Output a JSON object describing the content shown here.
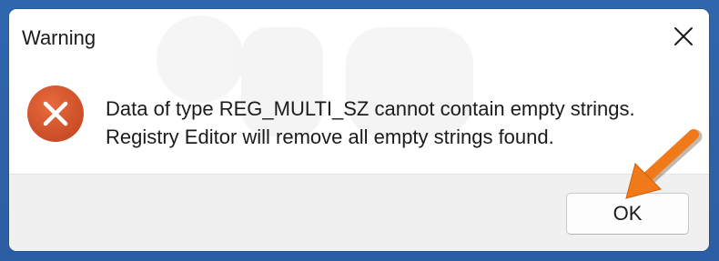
{
  "dialog": {
    "title": "Warning",
    "message_lines": [
      "Data of type REG_MULTI_SZ cannot contain empty strings.",
      "Registry Editor will remove all empty strings found."
    ],
    "ok_label": "OK"
  },
  "icons": {
    "close": "close-icon",
    "error": "error-icon",
    "annotation_arrow": "arrow-icon"
  },
  "colors": {
    "error_red": "#d9542b",
    "arrow_orange": "#f07a1a",
    "desktop_blue": "#2c5ea3"
  }
}
